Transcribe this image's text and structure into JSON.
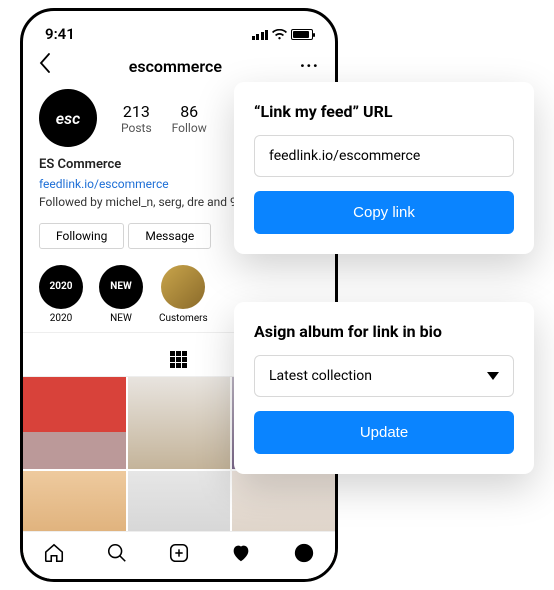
{
  "statusbar": {
    "time": "9:41"
  },
  "nav": {
    "title": "escommerce"
  },
  "profile": {
    "avatar_text": "esc",
    "stats": [
      {
        "num": "213",
        "label": "Posts"
      },
      {
        "num": "86",
        "label": "Follow"
      }
    ]
  },
  "bio": {
    "name": "ES Commerce",
    "link": "feedlink.io/escommerce",
    "followed_by": "Followed by michel_n, serg, dre and 91"
  },
  "actions": {
    "following": "Following",
    "message": "Message"
  },
  "highlights": [
    {
      "badge": "2020",
      "label": "2020"
    },
    {
      "badge": "NEW",
      "label": "NEW"
    },
    {
      "badge": "",
      "label": "Customers"
    }
  ],
  "card1": {
    "title": "“Link my feed” URL",
    "url": "feedlink.io/escommerce",
    "button": "Copy link"
  },
  "card2": {
    "title": "Asign album for link in bio",
    "selected": "Latest collection",
    "button": "Update"
  }
}
